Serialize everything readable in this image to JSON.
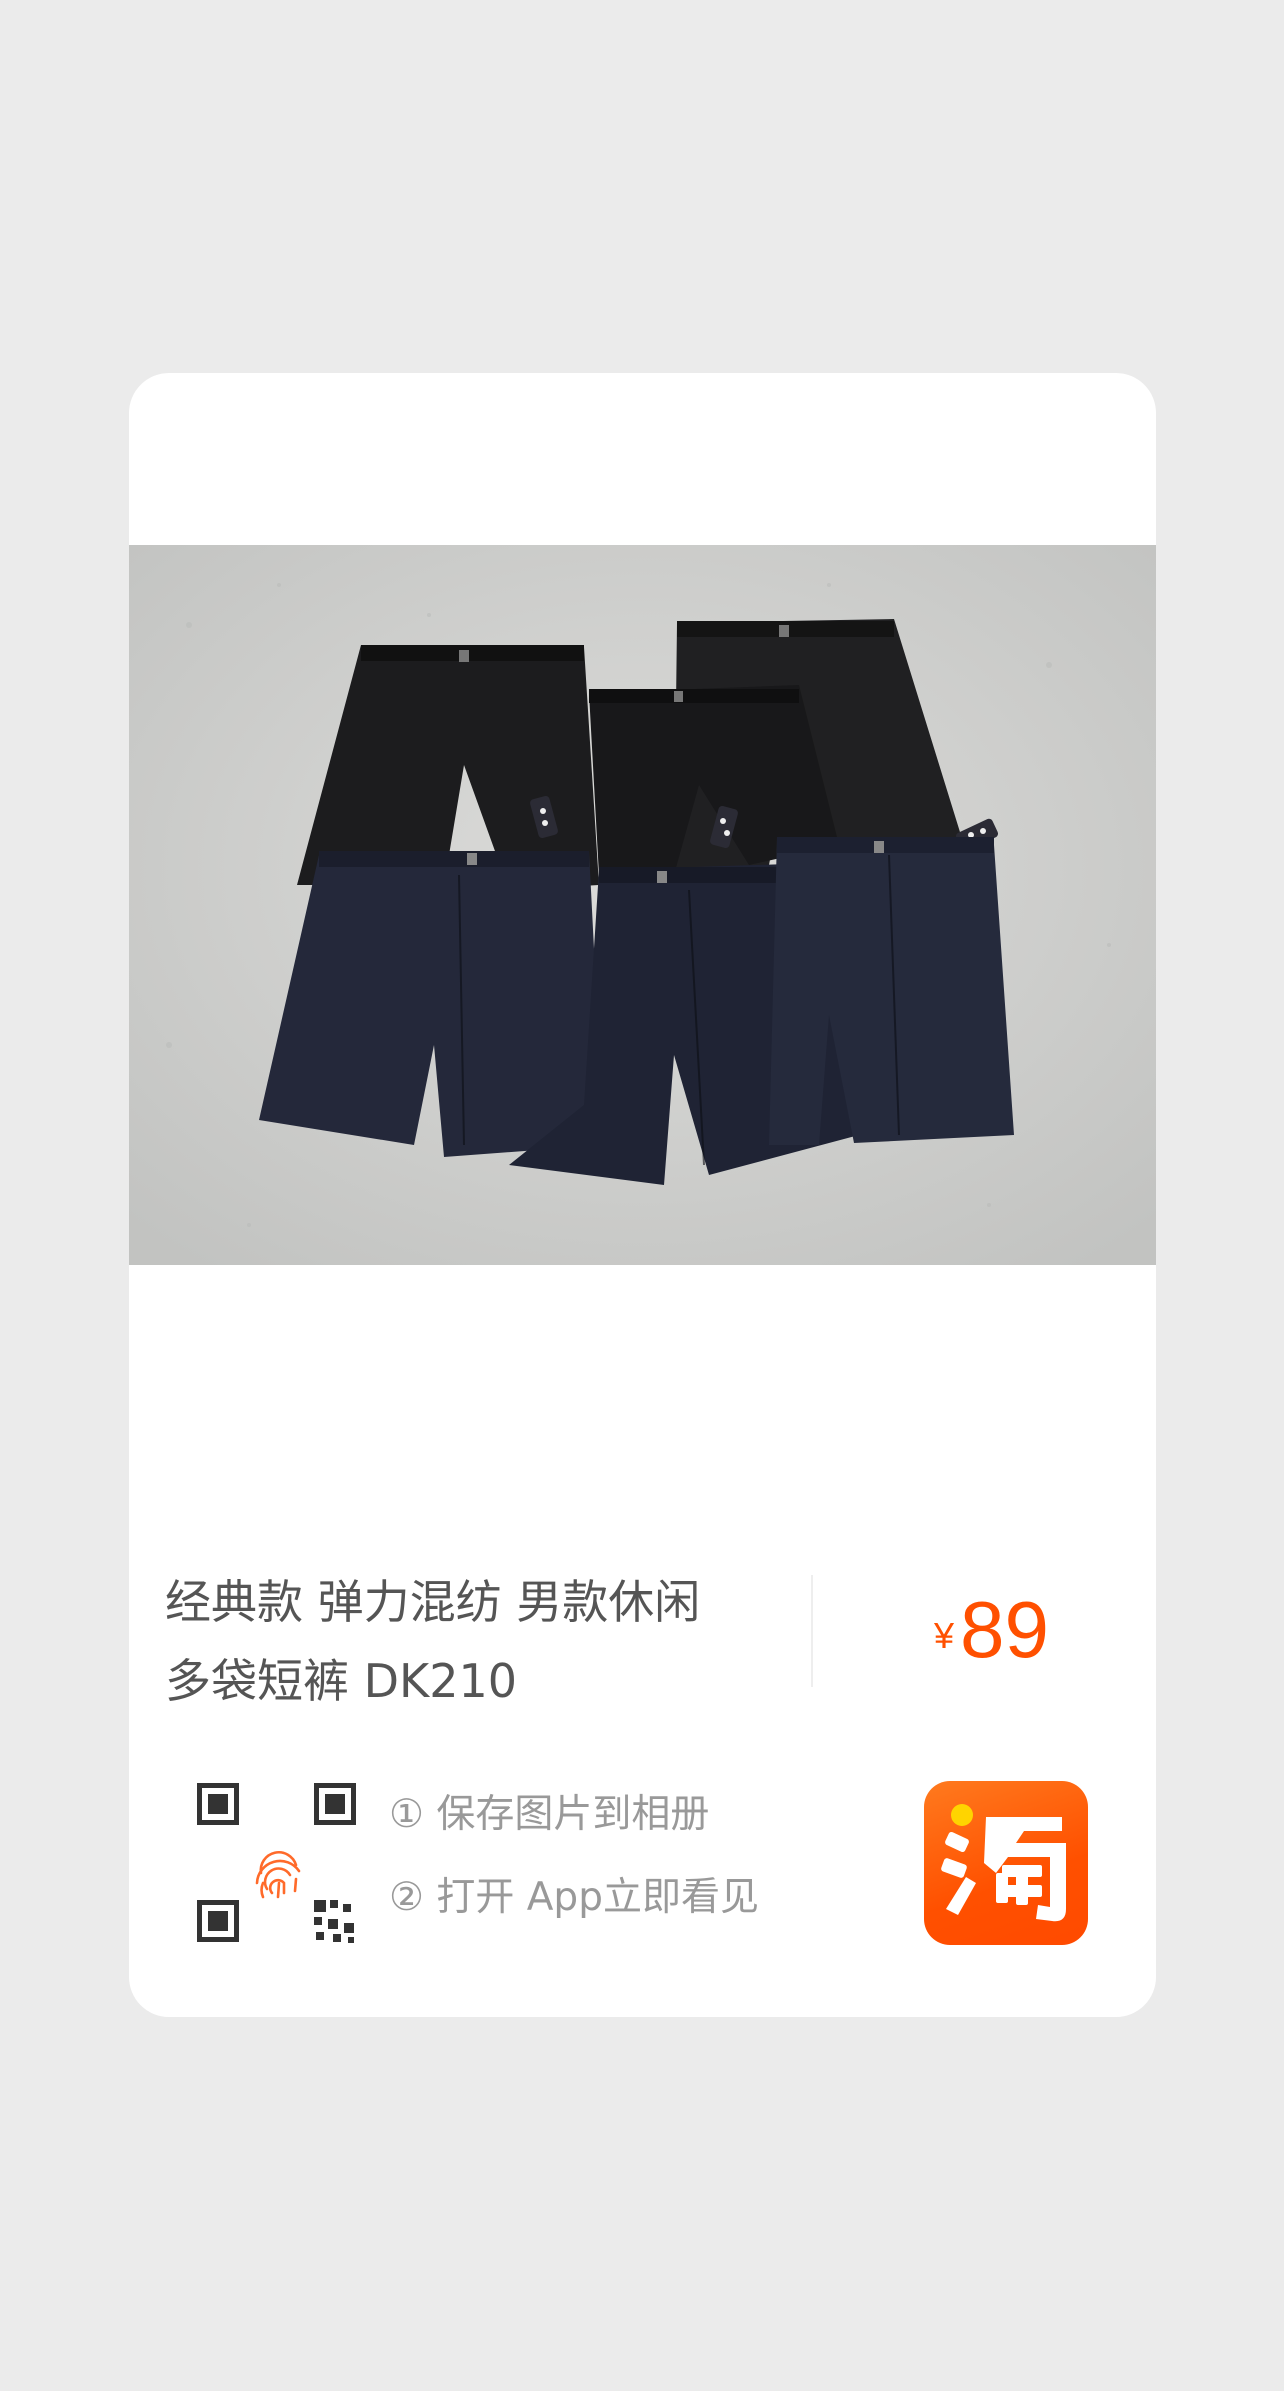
{
  "product": {
    "title_line1": "经典款  弹力混纺 男款休闲",
    "title_line2": "多袋短裤 DK210",
    "image_subject": "five folded men's casual shorts, black and navy, on concrete floor"
  },
  "price": {
    "currency": "¥",
    "amount": "89"
  },
  "instructions": {
    "step1": "① 保存图片到相册",
    "step2": "② 打开 App立即看见"
  },
  "app_icon": {
    "glyph": "淘",
    "name": "taobao-icon"
  },
  "colors": {
    "accent": "#ff5000",
    "background": "#ebebeb",
    "card": "#ffffff",
    "title_text": "#555555",
    "step_text": "#999999"
  }
}
